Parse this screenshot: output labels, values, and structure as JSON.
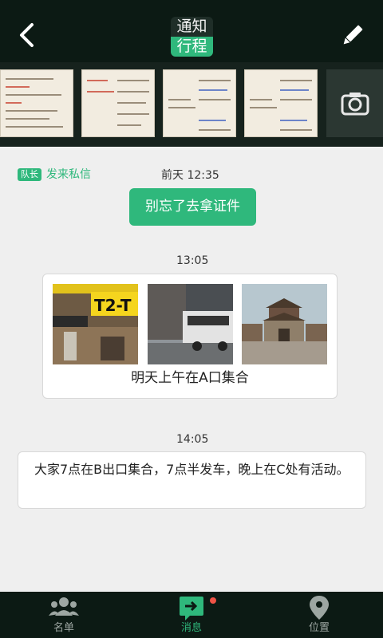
{
  "header": {
    "title_top": "通知",
    "title_bottom": "行程",
    "back_icon": "back-arrow-icon",
    "edit_icon": "pencil-icon"
  },
  "photo_strip": {
    "thumbnails": [
      {
        "name": "itinerary-document-1"
      },
      {
        "name": "itinerary-document-2"
      },
      {
        "name": "itinerary-document-3"
      },
      {
        "name": "itinerary-document-4"
      }
    ],
    "camera_icon": "camera-icon"
  },
  "messages": {
    "private": {
      "tag": "队长",
      "sender_text": "发来私信",
      "time": "前天  12:35",
      "body": "别忘了去拿证件"
    },
    "photo_message": {
      "time": "13:05",
      "caption": "明天上午在A口集合",
      "photos": [
        "airport-sign-photo",
        "street-bus-photo",
        "ancient-gate-photo"
      ]
    },
    "text_message": {
      "time": "14:05",
      "body": "大家7点在B出口集合，7点半发车，晚上在C处有活动。"
    }
  },
  "tabbar": {
    "tabs": [
      {
        "label": "名单",
        "icon": "people-icon",
        "active": false
      },
      {
        "label": "消息",
        "icon": "message-icon",
        "active": true,
        "badge": "unread-dot"
      },
      {
        "label": "位置",
        "icon": "location-pin-icon",
        "active": false
      }
    ]
  },
  "colors": {
    "accent": "#2fb87c",
    "header_bg": "#0c1a14",
    "badge_red": "#f05346"
  }
}
